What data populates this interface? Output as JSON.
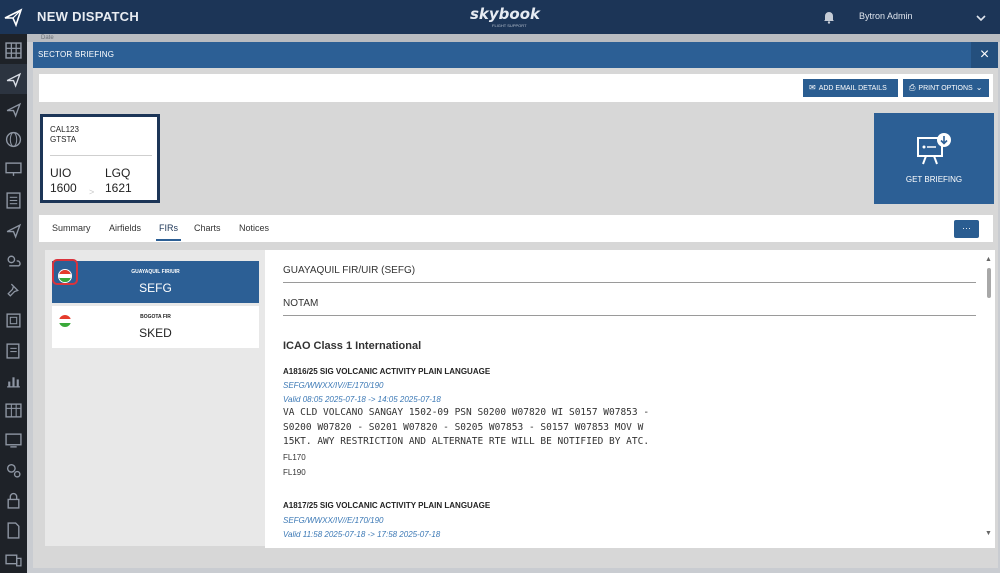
{
  "app": {
    "title": "NEW DISPATCH",
    "logo": "skybook",
    "logo_sub": "FLIGHT SUPPORT",
    "user": "Bytron Admin",
    "bg_text": "Date"
  },
  "modal": {
    "title": "SECTOR BRIEFING",
    "close": "×"
  },
  "toolbar": {
    "email_label": "ADD EMAIL DETAILS",
    "print_label": "PRINT OPTIONS"
  },
  "flight": {
    "callsign": "CAL123",
    "registration": "GTSTA",
    "departure": "UIO",
    "departure_time": "1600",
    "arrival": "LGQ",
    "arrival_time": "1621",
    "arrow": ">"
  },
  "get_briefing": {
    "label": "GET BRIEFING"
  },
  "tabs": [
    {
      "label": "Summary"
    },
    {
      "label": "Airfields"
    },
    {
      "label": "FIRs"
    },
    {
      "label": "Charts"
    },
    {
      "label": "Notices"
    }
  ],
  "active_tab": "FIRs",
  "more_label": "···",
  "firs": [
    {
      "name": "GUAYAQUIL FIR/UIR",
      "code": "SEFG"
    },
    {
      "name": "BOGOTA FIR",
      "code": "SKED"
    }
  ],
  "detail": {
    "fir_heading": "GUAYAQUIL FIR/UIR (SEFG)",
    "section": "NOTAM",
    "class_heading": "ICAO Class 1 International",
    "notams": [
      {
        "id": "A1816/25 SIG VOLCANIC ACTIVITY PLAIN LANGUAGE",
        "route": "SEFG/WWXX/IV//E/170/190",
        "valid": "Valid 08:05 2025-07-18 -> 14:05 2025-07-18",
        "body": "VA CLD VOLCANO SANGAY 1502-09 PSN S0200 W07820 WI S0157 W07853 -\nS0200 W07820 - S0201 W07820 - S0205 W07853 - S0157 W07853 MOV W\n15KT. AWY RESTRICTION AND ALTERNATE RTE WILL BE NOTIFIED BY ATC.",
        "lower": "FL170",
        "upper": "FL190"
      },
      {
        "id": "A1817/25 SIG VOLCANIC ACTIVITY PLAIN LANGUAGE",
        "route": "SEFG/WWXX/IV//E/170/190",
        "valid": "Valid 11:58 2025-07-18 -> 17:58 2025-07-18"
      }
    ]
  },
  "colors": {
    "navy": "#1c3557",
    "accent": "#2c5f95",
    "link": "#3b78b5",
    "highlight": "#d9333c"
  },
  "icons": {
    "rail": [
      "grid-icon",
      "plane-icon",
      "plane-icon",
      "globe-icon",
      "monitor-icon",
      "list-icon",
      "plane-icon",
      "weather-icon",
      "pin-icon",
      "doc-icon",
      "checklist-icon",
      "chart-icon",
      "table-icon",
      "screen-icon",
      "gears-icon",
      "lock-icon",
      "file-icon",
      "devices-icon"
    ]
  }
}
